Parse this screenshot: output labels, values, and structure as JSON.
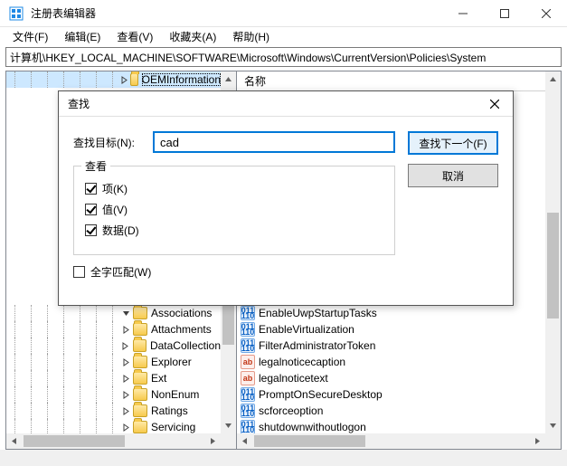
{
  "window": {
    "title": "注册表编辑器"
  },
  "menu": {
    "file": "文件(F)",
    "edit": "编辑(E)",
    "view": "查看(V)",
    "favorites": "收藏夹(A)",
    "help": "帮助(H)"
  },
  "address": "计算机\\HKEY_LOCAL_MACHINE\\SOFTWARE\\Microsoft\\Windows\\CurrentVersion\\Policies\\System",
  "tree": {
    "items": [
      {
        "indent": 7,
        "expanded": false,
        "label": "OEMInformation",
        "selected": true
      },
      {
        "indent": 7,
        "expanded": true,
        "label": "Associations"
      },
      {
        "indent": 7,
        "expanded": false,
        "label": "Attachments"
      },
      {
        "indent": 7,
        "expanded": false,
        "label": "DataCollection"
      },
      {
        "indent": 7,
        "expanded": false,
        "label": "Explorer"
      },
      {
        "indent": 7,
        "expanded": false,
        "label": "Ext"
      },
      {
        "indent": 7,
        "expanded": false,
        "label": "NonEnum"
      },
      {
        "indent": 7,
        "expanded": false,
        "label": "Ratings"
      },
      {
        "indent": 7,
        "expanded": false,
        "label": "Servicing"
      }
    ]
  },
  "list": {
    "header_name": "名称",
    "rows": [
      {
        "type": "dword",
        "name": "EnableUwpStartupTasks"
      },
      {
        "type": "dword",
        "name": "EnableVirtualization"
      },
      {
        "type": "dword",
        "name": "FilterAdministratorToken"
      },
      {
        "type": "sz",
        "name": "legalnoticecaption"
      },
      {
        "type": "sz",
        "name": "legalnoticetext"
      },
      {
        "type": "dword",
        "name": "PromptOnSecureDesktop"
      },
      {
        "type": "dword",
        "name": "scforceoption"
      },
      {
        "type": "dword",
        "name": "shutdownwithoutlogon"
      }
    ]
  },
  "dialog": {
    "title": "查找",
    "target_label": "查找目标(N):",
    "target_value": "cad",
    "lookat_legend": "查看",
    "chk_keys": "项(K)",
    "chk_values": "值(V)",
    "chk_data": "数据(D)",
    "chk_whole": "全字匹配(W)",
    "btn_findnext": "查找下一个(F)",
    "btn_cancel": "取消"
  },
  "icon_text": {
    "dword": "011\n110",
    "sz": "ab"
  }
}
